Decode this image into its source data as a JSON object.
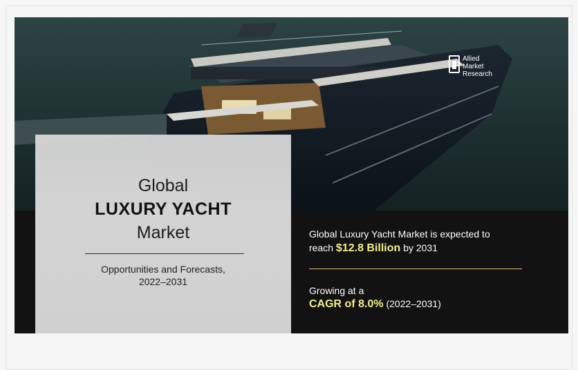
{
  "logo": {
    "line1": "Allied",
    "line2": "Market",
    "line3": "Research"
  },
  "left_panel": {
    "title_line1": "Global",
    "title_line2": "LUXURY YACHT",
    "title_line3": "Market",
    "subtitle_line1": "Opportunities and Forecasts,",
    "subtitle_line2": "2022–2031"
  },
  "right_panel": {
    "line1": "Global Luxury Yacht Market is expected to",
    "reach_prefix": "reach",
    "value_highlight": "$12.8 Billion",
    "reach_suffix": "by 2031",
    "growing": "Growing at a",
    "cagr_highlight": "CAGR of 8.0%",
    "cagr_period": "(2022–2031)"
  },
  "colors": {
    "accent_yellow": "#f2f08a",
    "dark_bg": "#121212",
    "panel_gray": "#d3d3d3"
  }
}
